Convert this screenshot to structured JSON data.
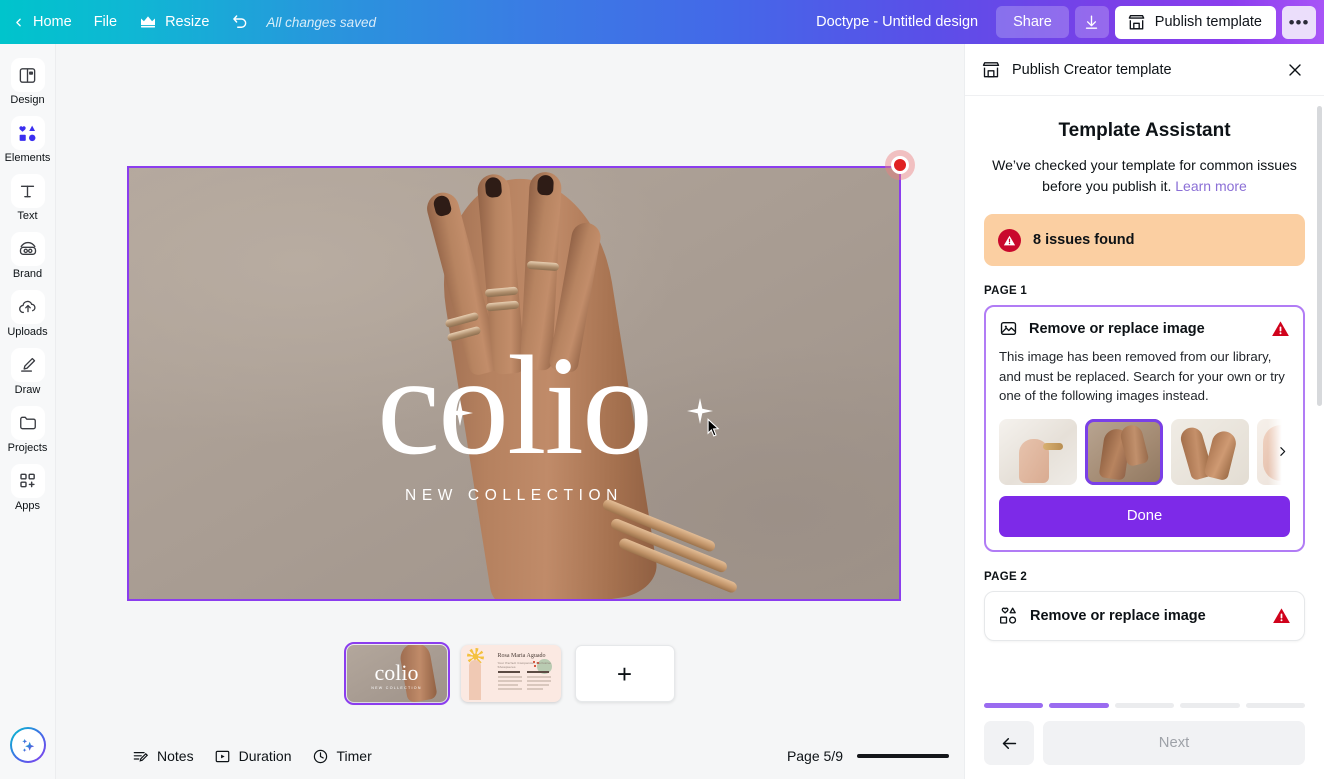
{
  "topbar": {
    "back_icon": "chevron-left-icon",
    "home": "Home",
    "file": "File",
    "resize": "Resize",
    "crown_icon": "crown-icon",
    "undo_icon": "undo-icon",
    "saved_status": "All changes saved",
    "doc_title": "Doctype - Untitled design",
    "share": "Share",
    "download_icon": "download-icon",
    "publish": "Publish template",
    "store_icon": "storefront-icon",
    "more": "•••",
    "gradient_start": "#00c4cc",
    "gradient_end": "#a855f7"
  },
  "rail": {
    "items": [
      {
        "label": "Design",
        "icon": "design-icon"
      },
      {
        "label": "Elements",
        "icon": "elements-icon"
      },
      {
        "label": "Text",
        "icon": "text-icon"
      },
      {
        "label": "Brand",
        "icon": "brand-icon"
      },
      {
        "label": "Uploads",
        "icon": "uploads-icon"
      },
      {
        "label": "Draw",
        "icon": "draw-icon"
      },
      {
        "label": "Projects",
        "icon": "projects-icon"
      },
      {
        "label": "Apps",
        "icon": "apps-icon"
      }
    ],
    "magic_icon": "sparkles-icon"
  },
  "canvas": {
    "logo": "colio",
    "subtitle": "NEW COLLECTION",
    "selection_color": "#8b3dee",
    "marker_color": "#e02121",
    "background_color": "#ada197"
  },
  "thumbnails": {
    "page1": {
      "logo": "colio",
      "subtitle": "NEW COLLECTION"
    },
    "page2": {
      "name": "Rosa Maria Aguado",
      "role": "Your Perfect Companion. Exclusive Showpieces"
    },
    "add_label": "+"
  },
  "bottombar": {
    "notes": "Notes",
    "notes_icon": "notes-icon",
    "duration": "Duration",
    "duration_icon": "duration-icon",
    "timer": "Timer",
    "timer_icon": "timer-icon",
    "page_count": "Page 5/9",
    "zoom_slider": "zoom-slider"
  },
  "panel": {
    "header_title": "Publish Creator template",
    "header_icon": "storefront-icon",
    "close_icon": "close-icon",
    "assistant_title": "Template Assistant",
    "assistant_desc": "We’ve checked your template for common issues before you publish it.",
    "learn_more": "Learn more",
    "issues_found": "8 issues found",
    "issues_banner_color": "#fbcfa2",
    "warning_color": "#c9082c",
    "page1_label": "PAGE 1",
    "page2_label": "PAGE 2",
    "issue1": {
      "title": "Remove or replace image",
      "icon": "image-icon",
      "warning_icon": "warning-icon",
      "description": "This image has been removed from our library, and must be replaced. Search for your own or try one of the following images instead.",
      "done_label": "Done",
      "next_arrow_icon": "chevron-right-icon",
      "suggestions": [
        {
          "name": "suggestion-white-sleeve-bracelet",
          "selected": false
        },
        {
          "name": "suggestion-two-hands-rings",
          "selected": true
        },
        {
          "name": "suggestion-hands-bracelet",
          "selected": false
        },
        {
          "name": "suggestion-ear-hoop-earring",
          "selected": false
        }
      ]
    },
    "issue2": {
      "title": "Remove or replace image",
      "icon": "shapes-icon",
      "warning_icon": "warning-icon"
    },
    "progress": {
      "total": 5,
      "filled": 2,
      "fill_color": "#9a6bf0",
      "track_color": "#ebecee"
    },
    "back_icon": "arrow-left-icon",
    "next_label": "Next"
  }
}
